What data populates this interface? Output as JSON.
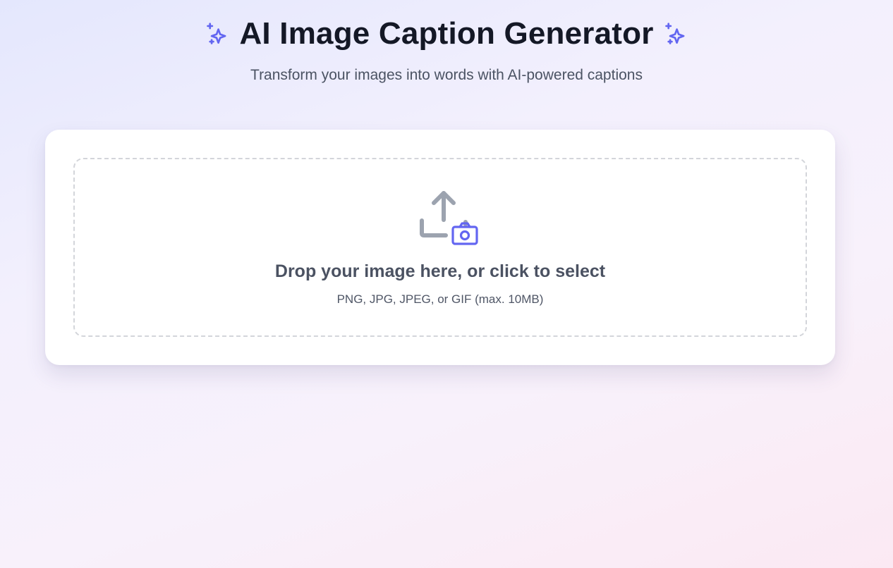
{
  "header": {
    "title": "AI Image Caption Generator",
    "subtitle": "Transform your images into words with AI-powered captions",
    "left_icon": "sparkles-icon",
    "right_icon": "sparkles-icon"
  },
  "upload": {
    "icon": "upload-camera-icon",
    "prompt": "Drop your image here, or click to select",
    "hint": "PNG, JPG, JPEG, or GIF (max. 10MB)"
  },
  "colors": {
    "accent": "#6366f1",
    "title_text": "#141826",
    "muted_text": "#4b5363",
    "upload_icon_gray": "#9ca3af",
    "dropzone_border": "#d3d5da",
    "card_background": "#ffffff"
  }
}
